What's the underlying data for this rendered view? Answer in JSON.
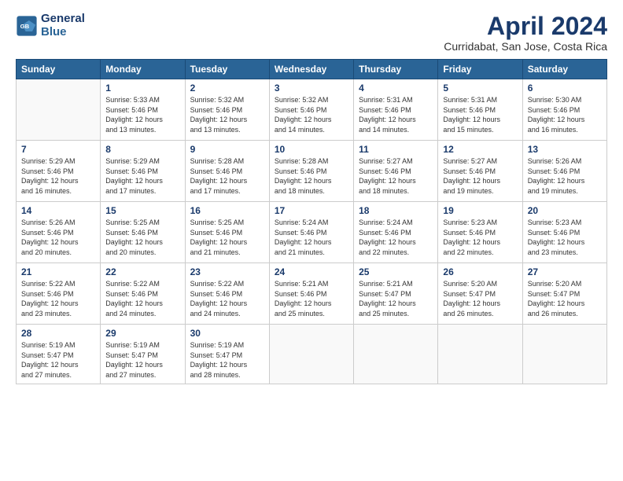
{
  "header": {
    "logo_line1": "General",
    "logo_line2": "Blue",
    "title": "April 2024",
    "subtitle": "Curridabat, San Jose, Costa Rica"
  },
  "days_of_week": [
    "Sunday",
    "Monday",
    "Tuesday",
    "Wednesday",
    "Thursday",
    "Friday",
    "Saturday"
  ],
  "weeks": [
    [
      {
        "num": "",
        "info": ""
      },
      {
        "num": "1",
        "info": "Sunrise: 5:33 AM\nSunset: 5:46 PM\nDaylight: 12 hours\nand 13 minutes."
      },
      {
        "num": "2",
        "info": "Sunrise: 5:32 AM\nSunset: 5:46 PM\nDaylight: 12 hours\nand 13 minutes."
      },
      {
        "num": "3",
        "info": "Sunrise: 5:32 AM\nSunset: 5:46 PM\nDaylight: 12 hours\nand 14 minutes."
      },
      {
        "num": "4",
        "info": "Sunrise: 5:31 AM\nSunset: 5:46 PM\nDaylight: 12 hours\nand 14 minutes."
      },
      {
        "num": "5",
        "info": "Sunrise: 5:31 AM\nSunset: 5:46 PM\nDaylight: 12 hours\nand 15 minutes."
      },
      {
        "num": "6",
        "info": "Sunrise: 5:30 AM\nSunset: 5:46 PM\nDaylight: 12 hours\nand 16 minutes."
      }
    ],
    [
      {
        "num": "7",
        "info": "Sunrise: 5:29 AM\nSunset: 5:46 PM\nDaylight: 12 hours\nand 16 minutes."
      },
      {
        "num": "8",
        "info": "Sunrise: 5:29 AM\nSunset: 5:46 PM\nDaylight: 12 hours\nand 17 minutes."
      },
      {
        "num": "9",
        "info": "Sunrise: 5:28 AM\nSunset: 5:46 PM\nDaylight: 12 hours\nand 17 minutes."
      },
      {
        "num": "10",
        "info": "Sunrise: 5:28 AM\nSunset: 5:46 PM\nDaylight: 12 hours\nand 18 minutes."
      },
      {
        "num": "11",
        "info": "Sunrise: 5:27 AM\nSunset: 5:46 PM\nDaylight: 12 hours\nand 18 minutes."
      },
      {
        "num": "12",
        "info": "Sunrise: 5:27 AM\nSunset: 5:46 PM\nDaylight: 12 hours\nand 19 minutes."
      },
      {
        "num": "13",
        "info": "Sunrise: 5:26 AM\nSunset: 5:46 PM\nDaylight: 12 hours\nand 19 minutes."
      }
    ],
    [
      {
        "num": "14",
        "info": "Sunrise: 5:26 AM\nSunset: 5:46 PM\nDaylight: 12 hours\nand 20 minutes."
      },
      {
        "num": "15",
        "info": "Sunrise: 5:25 AM\nSunset: 5:46 PM\nDaylight: 12 hours\nand 20 minutes."
      },
      {
        "num": "16",
        "info": "Sunrise: 5:25 AM\nSunset: 5:46 PM\nDaylight: 12 hours\nand 21 minutes."
      },
      {
        "num": "17",
        "info": "Sunrise: 5:24 AM\nSunset: 5:46 PM\nDaylight: 12 hours\nand 21 minutes."
      },
      {
        "num": "18",
        "info": "Sunrise: 5:24 AM\nSunset: 5:46 PM\nDaylight: 12 hours\nand 22 minutes."
      },
      {
        "num": "19",
        "info": "Sunrise: 5:23 AM\nSunset: 5:46 PM\nDaylight: 12 hours\nand 22 minutes."
      },
      {
        "num": "20",
        "info": "Sunrise: 5:23 AM\nSunset: 5:46 PM\nDaylight: 12 hours\nand 23 minutes."
      }
    ],
    [
      {
        "num": "21",
        "info": "Sunrise: 5:22 AM\nSunset: 5:46 PM\nDaylight: 12 hours\nand 23 minutes."
      },
      {
        "num": "22",
        "info": "Sunrise: 5:22 AM\nSunset: 5:46 PM\nDaylight: 12 hours\nand 24 minutes."
      },
      {
        "num": "23",
        "info": "Sunrise: 5:22 AM\nSunset: 5:46 PM\nDaylight: 12 hours\nand 24 minutes."
      },
      {
        "num": "24",
        "info": "Sunrise: 5:21 AM\nSunset: 5:46 PM\nDaylight: 12 hours\nand 25 minutes."
      },
      {
        "num": "25",
        "info": "Sunrise: 5:21 AM\nSunset: 5:47 PM\nDaylight: 12 hours\nand 25 minutes."
      },
      {
        "num": "26",
        "info": "Sunrise: 5:20 AM\nSunset: 5:47 PM\nDaylight: 12 hours\nand 26 minutes."
      },
      {
        "num": "27",
        "info": "Sunrise: 5:20 AM\nSunset: 5:47 PM\nDaylight: 12 hours\nand 26 minutes."
      }
    ],
    [
      {
        "num": "28",
        "info": "Sunrise: 5:19 AM\nSunset: 5:47 PM\nDaylight: 12 hours\nand 27 minutes."
      },
      {
        "num": "29",
        "info": "Sunrise: 5:19 AM\nSunset: 5:47 PM\nDaylight: 12 hours\nand 27 minutes."
      },
      {
        "num": "30",
        "info": "Sunrise: 5:19 AM\nSunset: 5:47 PM\nDaylight: 12 hours\nand 28 minutes."
      },
      {
        "num": "",
        "info": ""
      },
      {
        "num": "",
        "info": ""
      },
      {
        "num": "",
        "info": ""
      },
      {
        "num": "",
        "info": ""
      }
    ]
  ]
}
